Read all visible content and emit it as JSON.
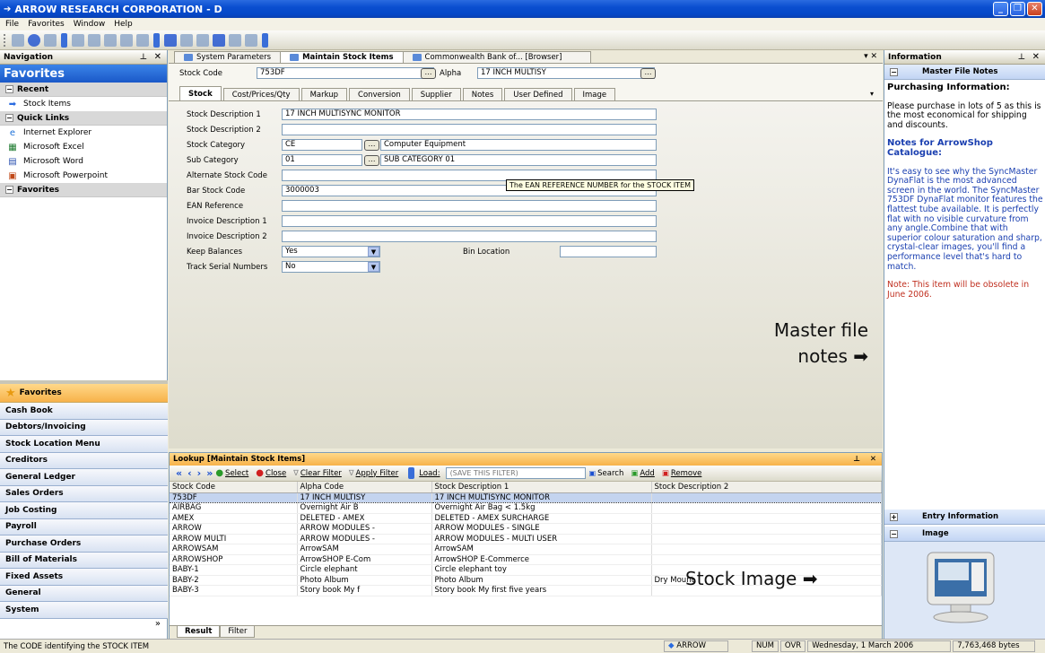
{
  "window": {
    "title": "ARROW RESEARCH CORPORATION - D"
  },
  "menu": [
    "File",
    "Favorites",
    "Window",
    "Help"
  ],
  "nav": {
    "header": "Navigation",
    "favorites_title": "Favorites",
    "recent_label": "Recent",
    "recent_items": [
      "Stock Items"
    ],
    "quick_links_label": "Quick Links",
    "quick_links": [
      "Internet Explorer",
      "Microsoft Excel",
      "Microsoft Word",
      "Microsoft Powerpoint"
    ],
    "favorites_group_label": "Favorites",
    "favorites_button": "Favorites",
    "modules": [
      "Cash Book",
      "Debtors/Invoicing",
      "Stock Location Menu",
      "Creditors",
      "General Ledger",
      "Sales Orders",
      "Job Costing",
      "Payroll",
      "Purchase Orders",
      "Bill of Materials",
      "Fixed Assets",
      "General",
      "System"
    ]
  },
  "doc_tabs": [
    "System Parameters",
    "Maintain Stock Items",
    "Commonwealth Bank of... [Browser]"
  ],
  "stock": {
    "code_label": "Stock Code",
    "code_value": "753DF",
    "alpha_label": "Alpha",
    "alpha_value": "17 INCH MULTISY",
    "subtabs": [
      "Stock",
      "Cost/Prices/Qty",
      "Markup",
      "Conversion",
      "Supplier",
      "Notes",
      "User Defined",
      "Image"
    ],
    "fields": {
      "desc1_label": "Stock Description 1",
      "desc1_value": "17 INCH MULTISYNC MONITOR",
      "desc2_label": "Stock Description 2",
      "desc2_value": "",
      "category_label": "Stock Category",
      "category_code": "CE",
      "category_name": "Computer Equipment",
      "subcat_label": "Sub Category",
      "subcat_code": "01",
      "subcat_name": "SUB CATEGORY 01",
      "alt_label": "Alternate Stock Code",
      "alt_value": "",
      "bar_label": "Bar Stock Code",
      "bar_value": "3000003",
      "ean_label": "EAN Reference",
      "ean_value": "",
      "inv1_label": "Invoice Description 1",
      "inv1_value": "",
      "inv2_label": "Invoice Description 2",
      "inv2_value": "",
      "keep_label": "Keep Balances",
      "keep_value": "Yes",
      "bin_label": "Bin Location",
      "bin_value": "",
      "track_label": "Track Serial Numbers",
      "track_value": "No"
    },
    "tooltip": "The EAN REFERENCE NUMBER for the STOCK ITEM"
  },
  "annotations": {
    "master": "Master file notes ➡",
    "image": "Stock Image ➡"
  },
  "lookup": {
    "title": "Lookup [Maintain Stock Items]",
    "tools": {
      "select": "Select",
      "close": "Close",
      "clear": "Clear Filter",
      "apply": "Apply Filter",
      "load": "Load:",
      "filter_placeholder": "(SAVE THIS FILTER)",
      "search": "Search",
      "add": "Add",
      "remove": "Remove"
    },
    "columns": [
      "Stock Code",
      "Alpha Code",
      "Stock Description 1",
      "Stock Description 2"
    ],
    "rows": [
      [
        "753DF",
        "17 INCH MULTISY",
        "17 INCH MULTISYNC MONITOR",
        ""
      ],
      [
        "AIRBAG",
        "Overnight Air B",
        "Overnight Air Bag < 1.5kg",
        ""
      ],
      [
        "AMEX",
        "DELETED - AMEX",
        "DELETED - AMEX SURCHARGE",
        ""
      ],
      [
        "ARROW",
        "ARROW MODULES -",
        "ARROW MODULES - SINGLE",
        ""
      ],
      [
        "ARROW MULTI",
        "ARROW MODULES -",
        "ARROW MODULES - MULTI USER",
        ""
      ],
      [
        "ARROWSAM",
        "ArrowSAM",
        "ArrowSAM",
        ""
      ],
      [
        "ARROWSHOP",
        "ArrowSHOP E-Com",
        "ArrowSHOP E-Commerce",
        ""
      ],
      [
        "BABY-1",
        "Circle elephant",
        "Circle elephant toy",
        ""
      ],
      [
        "BABY-2",
        "Photo Album",
        "Photo Album",
        "Dry Mount"
      ],
      [
        "BABY-3",
        "Story book My f",
        "Story book My first five years",
        ""
      ]
    ],
    "bottom_tabs": [
      "Result",
      "Filter"
    ]
  },
  "info": {
    "header": "Information",
    "notes_header": "Master File Notes",
    "heading": "Purchasing Information:",
    "p1": "Please purchase in lots of 5 as this is the most economical for shipping and discounts.",
    "heading2": "Notes for ArrowShop Catalogue:",
    "p2": "It's easy to see why the SyncMaster DynaFlat is the most advanced screen in the world. The SyncMaster 753DF DynaFlat monitor features the flattest tube available. It is perfectly flat with no visible curvature from any angle.Combine that with superior colour saturation and sharp, crystal-clear images, you'll find a performance level that's hard to match.",
    "note": "Note: This item will be obsolete in June 2006.",
    "entry_header": "Entry Information",
    "image_header": "Image"
  },
  "status": {
    "left": "The CODE identifying the STOCK ITEM",
    "user": "ARROW",
    "num": "NUM",
    "ovr": "OVR",
    "date": "Wednesday, 1 March 2006",
    "mem": "7,763,468 bytes"
  }
}
